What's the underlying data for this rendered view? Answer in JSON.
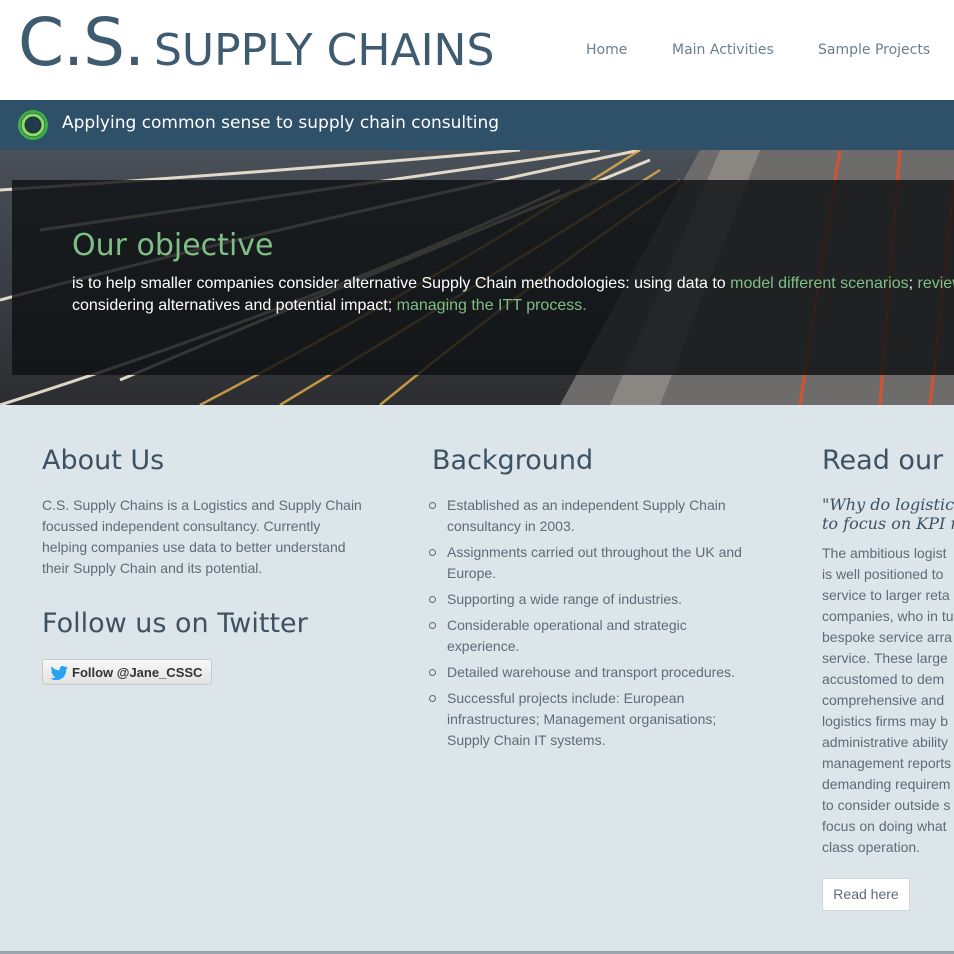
{
  "header": {
    "logo_cs": "C.S.",
    "logo_name": "SUPPLY CHAINS",
    "nav": [
      "Home",
      "Main Activities",
      "Sample Projects"
    ]
  },
  "tagbar": {
    "tagline": "Applying common sense to supply chain consulting",
    "icon": "green-ring-icon"
  },
  "hero": {
    "title": "Our objective",
    "line1_prefix": "is to help smaller companies consider alternative Supply Chain methodologies: using data to ",
    "link_model": "model different scenarios",
    "line1_suffix": "; ",
    "link_review": "review",
    "line2_prefix": "considering alternatives and potential impact; ",
    "link_itt": "managing the ITT process",
    "line2_suffix": "."
  },
  "about": {
    "title": "About Us",
    "lines": [
      "C.S. Supply Chains is a Logistics and Supply Chain",
      "focussed independent consultancy. Currently",
      "helping companies use data to better understand",
      "their Supply Chain and its potential."
    ]
  },
  "twitter": {
    "title": "Follow us on Twitter",
    "button": "Follow @Jane_CSSC"
  },
  "background": {
    "title": "Background",
    "items": [
      [
        "Established as an independent Supply Chain",
        "consultancy in 2003."
      ],
      [
        "Assignments carried out throughout the UK and",
        "Europe."
      ],
      [
        "Supporting a wide range of industries."
      ],
      [
        "Considerable operational and strategic",
        "experience."
      ],
      [
        "Detailed warehouse and transport procedures."
      ],
      [
        "Successful projects include: European",
        "infrastructures; Management organisations;",
        "Supply Chain IT systems."
      ]
    ]
  },
  "latest": {
    "title": "Read our la",
    "quote_lines": [
      "\"Why do logistics",
      "to focus on KPI re"
    ],
    "lines": [
      "The ambitious logist",
      "is well positioned to",
      "service to larger reta",
      "companies, who in tu",
      "bespoke service arra",
      "service. These large",
      "accustomed to dem",
      "comprehensive and",
      "logistics firms may b",
      "administrative ability",
      "management reports",
      "demanding requirem",
      "to consider outside s",
      "focus on doing what",
      "class operation."
    ],
    "button": "Read here"
  },
  "colors": {
    "accent_green": "#7fbf86",
    "brand_blue": "#3f5b6f",
    "tagbar_bg": "#2f5069",
    "content_bg": "#dce5ea"
  }
}
